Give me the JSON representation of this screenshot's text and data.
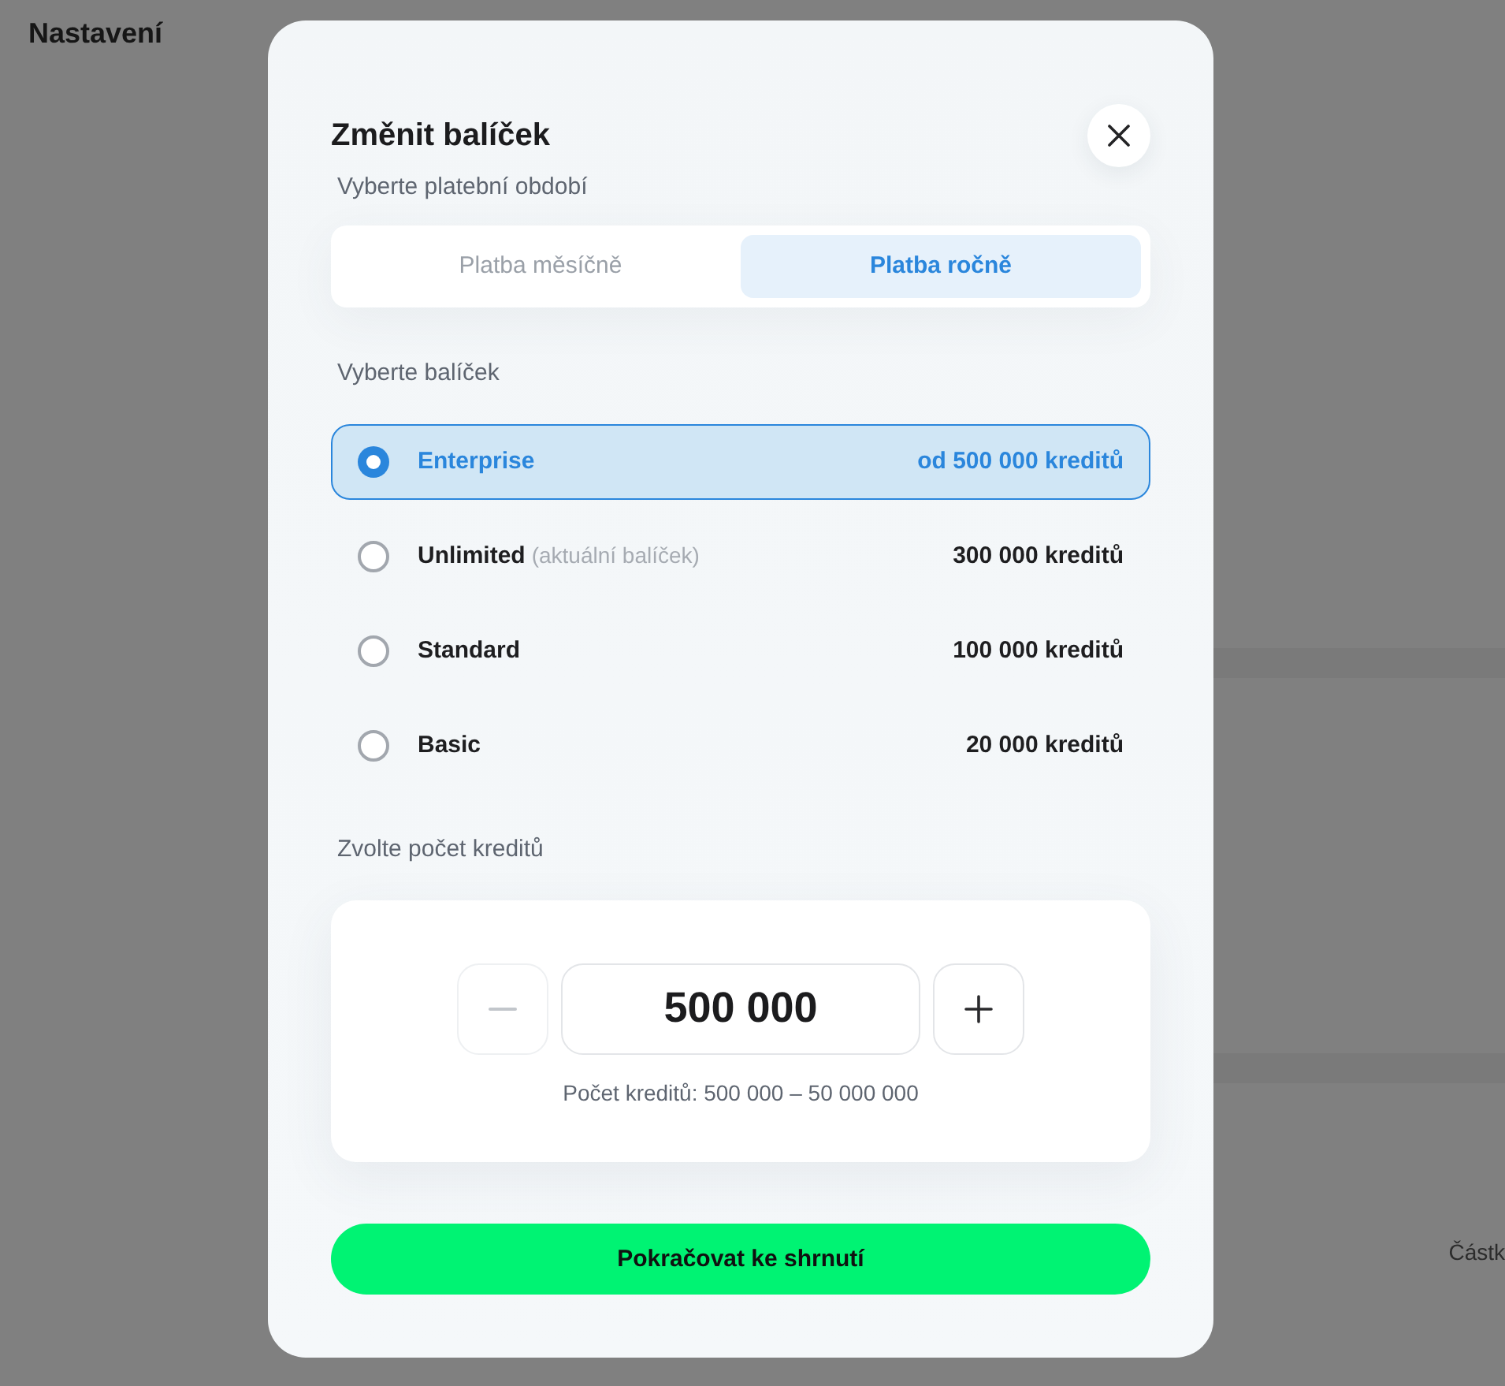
{
  "page": {
    "title": "Nastavení",
    "background_text": "Částk"
  },
  "dialog": {
    "title": "Změnit balíček",
    "billing_label": "Vyberte platební období",
    "billing_tabs": [
      {
        "label": "Platba měsíčně",
        "selected": false
      },
      {
        "label": "Platba ročně",
        "selected": true
      }
    ],
    "package_label": "Vyberte balíček",
    "packages": [
      {
        "name": "Enterprise",
        "credits": "od 500 000 kreditů",
        "selected": true
      },
      {
        "name": "Unlimited",
        "note": "(aktuální balíček)",
        "credits": "300 000 kreditů",
        "selected": false
      },
      {
        "name": "Standard",
        "credits": "100 000 kreditů",
        "selected": false
      },
      {
        "name": "Basic",
        "credits": "20 000 kreditů",
        "selected": false
      }
    ],
    "credits_label": "Zvolte počet kreditů",
    "stepper": {
      "value": "500 000",
      "decrement_disabled": true,
      "increment_disabled": false,
      "range": "Počet kreditů: 500 000 – 50 000 000"
    },
    "continue_button": "Pokračovat ke shrnutí"
  }
}
